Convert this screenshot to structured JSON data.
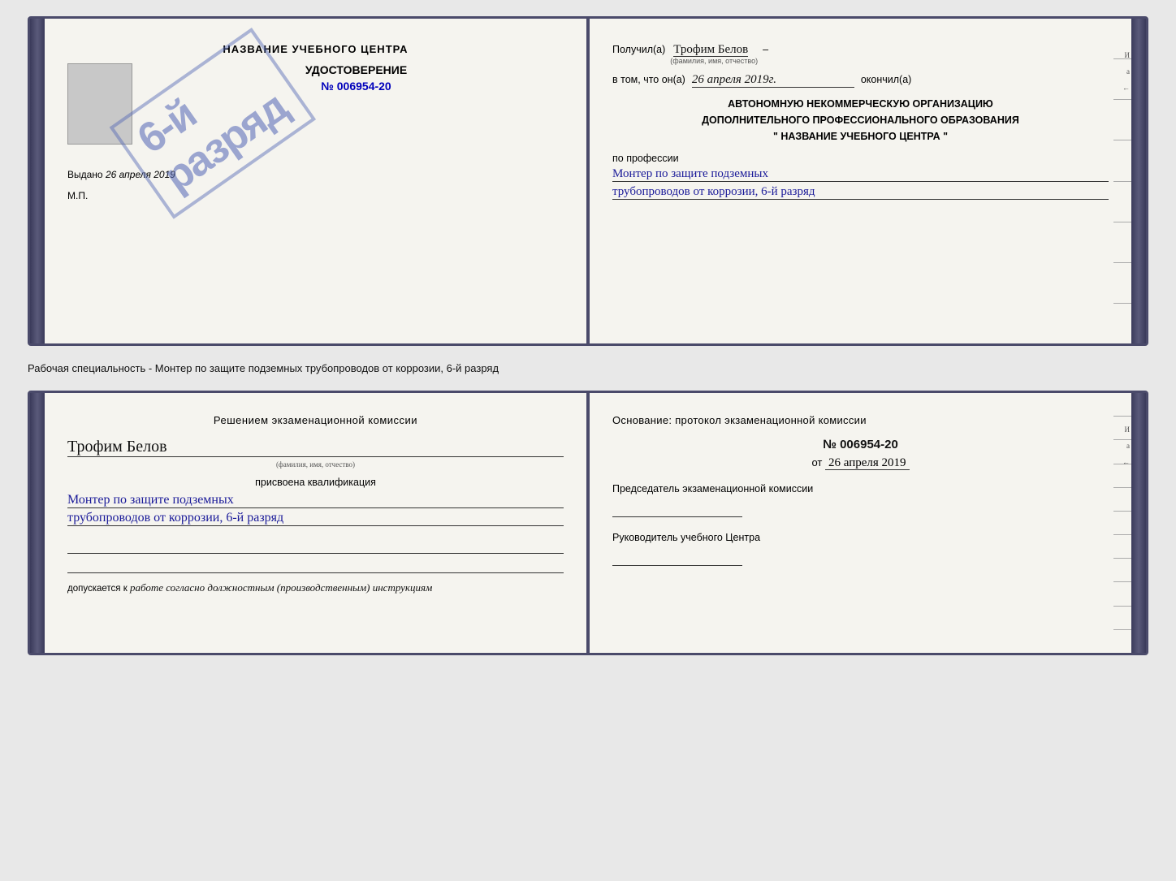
{
  "cert1": {
    "left": {
      "title": "НАЗВАНИЕ УЧЕБНОГО ЦЕНТРА",
      "stamp": "6-й\nразряд",
      "udost_label": "УДОСТОВЕРЕНИЕ",
      "number": "№ 006954-20",
      "issued_label": "Выдано",
      "issued_date": "26 апреля 2019",
      "mp_label": "М.П."
    },
    "right": {
      "poluchil_label": "Получил(а)",
      "name_handwritten": "Трофим Белов",
      "name_subtext": "(фамилия, имя, отчество)",
      "dash1": "–",
      "vtom_label": "в том, что он(а)",
      "date_handwritten": "26 апреля 2019г.",
      "okonchil_label": "окончил(а)",
      "org_line1": "АВТОНОМНУЮ НЕКОММЕРЧЕСКУЮ ОРГАНИЗАЦИЮ",
      "org_line2": "ДОПОЛНИТЕЛЬНОГО ПРОФЕССИОНАЛЬНОГО ОБРАЗОВАНИЯ",
      "org_line3": "\"   НАЗВАНИЕ УЧЕБНОГО ЦЕНТРА   \"",
      "po_professii": "по профессии",
      "profession_line1": "Монтер по защите подземных",
      "profession_line2": "трубопроводов от коррозии, 6-й разряд",
      "side_labels": [
        "И",
        "а",
        "←",
        "–",
        "–",
        "–",
        "–"
      ]
    }
  },
  "bottom_text": "Рабочая специальность - Монтер по защите подземных трубопроводов от коррозии, 6-й разряд",
  "cert2": {
    "left": {
      "header": "Решением  экзаменационной  комиссии",
      "name_handwritten": "Трофим Белов",
      "name_subtext": "(фамилия, имя, отчество)",
      "present_text": "присвоена квалификация",
      "qual_line1": "Монтер по защите подземных",
      "qual_line2": "трубопроводов от коррозии, 6-й разряд",
      "dopusk_label": "допускается к",
      "dopusk_italic": "работе согласно должностным (производственным) инструкциям"
    },
    "right": {
      "osnov_label": "Основание: протокол экзаменационной  комиссии",
      "number": "№  006954-20",
      "date_label": "от",
      "date_value": "26 апреля 2019",
      "predsedatel_label": "Председатель экзаменационной комиссии",
      "rukov_label": "Руководитель учебного Центра",
      "side_labels": [
        "–",
        "–",
        "–",
        "И",
        "а",
        "←",
        "–",
        "–",
        "–",
        "–"
      ]
    }
  }
}
